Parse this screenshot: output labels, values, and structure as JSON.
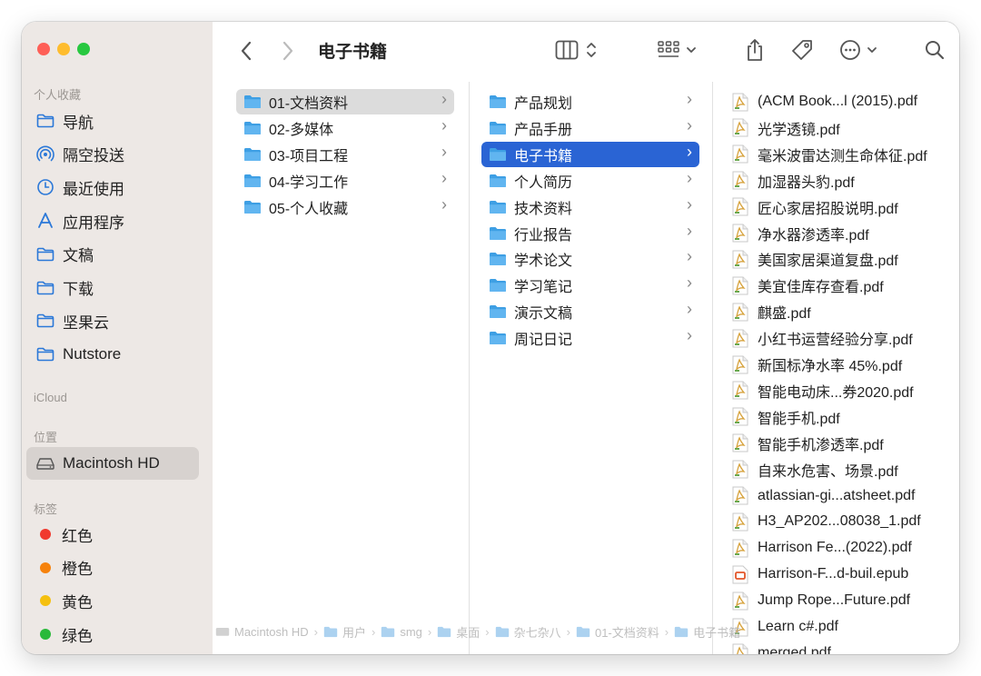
{
  "window": {
    "title": "电子书籍"
  },
  "sidebar": {
    "favorites_heading": "个人收藏",
    "favorites": [
      {
        "label": "导航",
        "icon": "folder-icon"
      },
      {
        "label": "隔空投送",
        "icon": "airdrop-icon"
      },
      {
        "label": "最近使用",
        "icon": "clock-icon"
      },
      {
        "label": "应用程序",
        "icon": "applications-icon"
      },
      {
        "label": "文稿",
        "icon": "folder-icon"
      },
      {
        "label": "下载",
        "icon": "folder-icon"
      },
      {
        "label": "坚果云",
        "icon": "folder-icon"
      },
      {
        "label": "Nutstore",
        "icon": "folder-icon"
      }
    ],
    "icloud_heading": "iCloud",
    "locations_heading": "位置",
    "locations": [
      {
        "label": "Macintosh HD",
        "icon": "disk-icon",
        "selected": true
      }
    ],
    "tags_heading": "标签",
    "tags": [
      {
        "label": "红色",
        "color": "#f0392e"
      },
      {
        "label": "橙色",
        "color": "#f6820c"
      },
      {
        "label": "黄色",
        "color": "#f5c00f"
      },
      {
        "label": "绿色",
        "color": "#2ab93a"
      }
    ]
  },
  "columns": {
    "col1": [
      {
        "label": "01-文档资料",
        "selected": "grey"
      },
      {
        "label": "02-多媒体"
      },
      {
        "label": "03-项目工程"
      },
      {
        "label": "04-学习工作"
      },
      {
        "label": "05-个人收藏"
      }
    ],
    "col2": [
      {
        "label": "产品规划"
      },
      {
        "label": "产品手册"
      },
      {
        "label": "电子书籍",
        "selected": "blue"
      },
      {
        "label": "个人简历"
      },
      {
        "label": "技术资料"
      },
      {
        "label": "行业报告"
      },
      {
        "label": "学术论文"
      },
      {
        "label": "学习笔记"
      },
      {
        "label": "演示文稿"
      },
      {
        "label": "周记日记"
      }
    ],
    "col3": [
      {
        "label": "(ACM Book...l (2015).pdf",
        "type": "pdf"
      },
      {
        "label": "光学透镜.pdf",
        "type": "pdf"
      },
      {
        "label": "毫米波雷达测生命体征.pdf",
        "type": "pdf"
      },
      {
        "label": "加湿器头豹.pdf",
        "type": "pdf"
      },
      {
        "label": "匠心家居招股说明.pdf",
        "type": "pdf"
      },
      {
        "label": "净水器渗透率.pdf",
        "type": "pdf"
      },
      {
        "label": "美国家居渠道复盘.pdf",
        "type": "pdf"
      },
      {
        "label": "美宜佳库存查看.pdf",
        "type": "pdf"
      },
      {
        "label": "麒盛.pdf",
        "type": "pdf"
      },
      {
        "label": "小红书运营经验分享.pdf",
        "type": "pdf"
      },
      {
        "label": "新国标净水率 45%.pdf",
        "type": "pdf"
      },
      {
        "label": "智能电动床...券2020.pdf",
        "type": "pdf"
      },
      {
        "label": "智能手机.pdf",
        "type": "pdf"
      },
      {
        "label": "智能手机渗透率.pdf",
        "type": "pdf"
      },
      {
        "label": "自来水危害、场景.pdf",
        "type": "pdf"
      },
      {
        "label": "atlassian-gi...atsheet.pdf",
        "type": "pdf"
      },
      {
        "label": "H3_AP202...08038_1.pdf",
        "type": "pdf"
      },
      {
        "label": "Harrison Fe...(2022).pdf",
        "type": "pdf"
      },
      {
        "label": "Harrison-F...d-buil.epub",
        "type": "epub"
      },
      {
        "label": "Jump Rope...Future.pdf",
        "type": "pdf"
      },
      {
        "label": "Learn c#.pdf",
        "type": "pdf"
      },
      {
        "label": "merged.pdf",
        "type": "pdf"
      }
    ]
  },
  "pathbar": [
    {
      "label": "Macintosh HD",
      "icon": "disk-icon"
    },
    {
      "label": "用户",
      "icon": "folder-icon"
    },
    {
      "label": "smg",
      "icon": "folder-icon"
    },
    {
      "label": "桌面",
      "icon": "folder-icon"
    },
    {
      "label": "杂七杂八",
      "icon": "folder-icon"
    },
    {
      "label": "01-文档资料",
      "icon": "folder-icon"
    },
    {
      "label": "电子书籍",
      "icon": "folder-icon"
    }
  ],
  "colors": {
    "selection_blue": "#2a64d4",
    "folder_blue": "#3e9fe4"
  }
}
